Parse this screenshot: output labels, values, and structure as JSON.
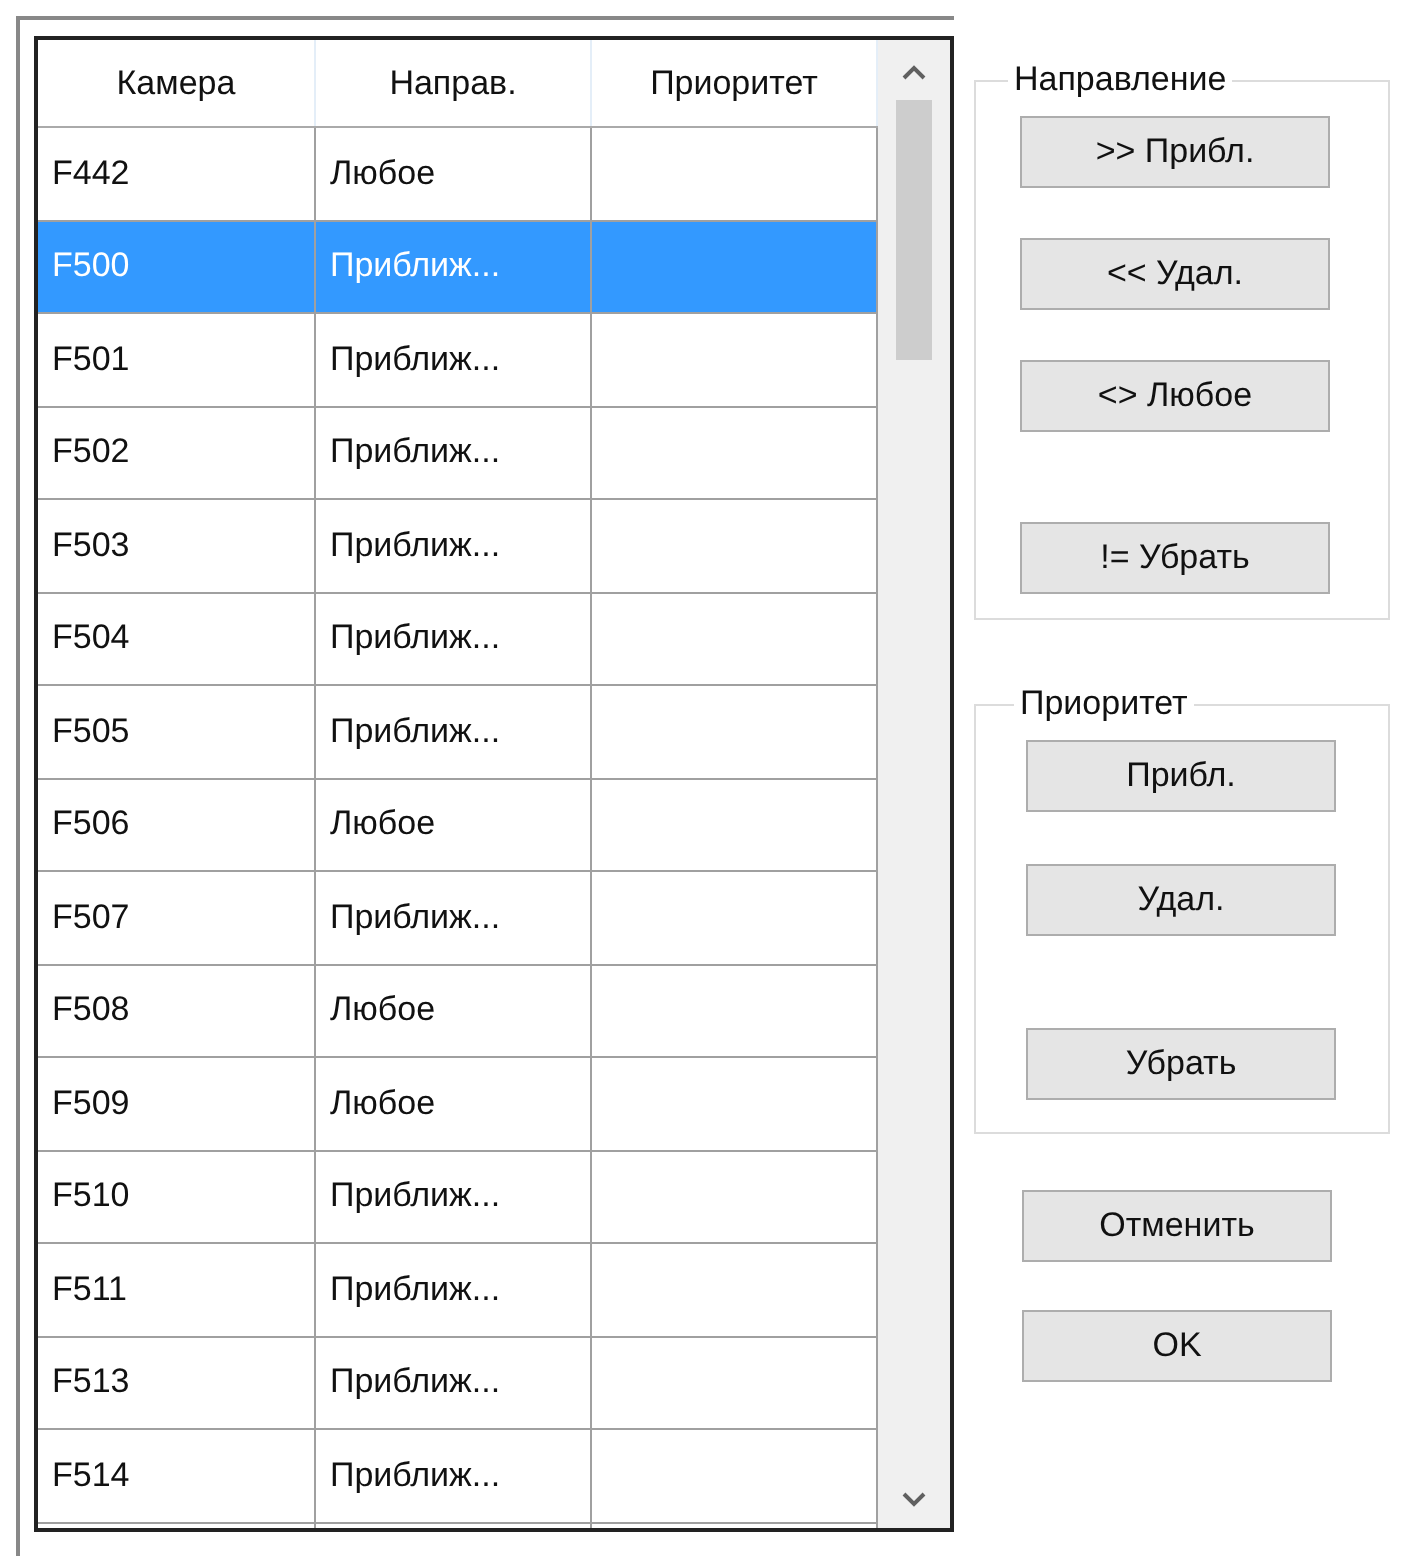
{
  "table": {
    "columns": [
      "Камера",
      "Направ.",
      "Приоритет"
    ],
    "rows": [
      {
        "camera": "F442",
        "direction": "Любое",
        "selected": false
      },
      {
        "camera": "F500",
        "direction": "Приближ...",
        "selected": true
      },
      {
        "camera": "F501",
        "direction": "Приближ...",
        "selected": false
      },
      {
        "camera": "F502",
        "direction": "Приближ...",
        "selected": false
      },
      {
        "camera": "F503",
        "direction": "Приближ...",
        "selected": false
      },
      {
        "camera": "F504",
        "direction": "Приближ...",
        "selected": false
      },
      {
        "camera": "F505",
        "direction": "Приближ...",
        "selected": false
      },
      {
        "camera": "F506",
        "direction": "Любое",
        "selected": false
      },
      {
        "camera": "F507",
        "direction": "Приближ...",
        "selected": false
      },
      {
        "camera": "F508",
        "direction": "Любое",
        "selected": false
      },
      {
        "camera": "F509",
        "direction": "Любое",
        "selected": false
      },
      {
        "camera": "F510",
        "direction": "Приближ...",
        "selected": false
      },
      {
        "camera": "F511",
        "direction": "Приближ...",
        "selected": false
      },
      {
        "camera": "F513",
        "direction": "Приближ...",
        "selected": false
      },
      {
        "camera": "F514",
        "direction": "Приближ...",
        "selected": false
      }
    ]
  },
  "direction_group": {
    "title": "Направление",
    "buttons": [
      ">> Прибл.",
      "<< Удал.",
      "<> Любое",
      "!= Убрать"
    ]
  },
  "priority_group": {
    "title": "Приоритет",
    "buttons": [
      "Прибл.",
      "Удал.",
      "Убрать"
    ]
  },
  "buttons": [
    "Отменить",
    "OK"
  ]
}
